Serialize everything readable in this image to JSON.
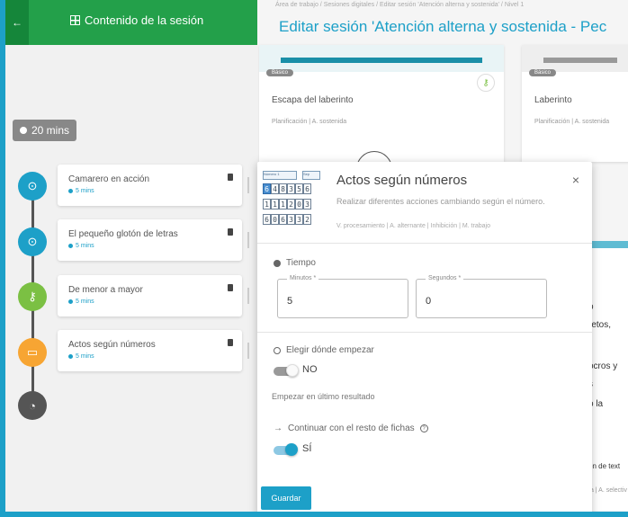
{
  "sidebar": {
    "back_icon": "←",
    "title": "Contenido de la sesión",
    "time_total": "20 mins",
    "items": [
      {
        "name": "Camarero en acción",
        "duration": "5 mins",
        "color": "#1da0c8",
        "icon": "⊙"
      },
      {
        "name": "El pequeño glotón de letras",
        "duration": "5 mins",
        "color": "#1da0c8",
        "icon": "⊙"
      },
      {
        "name": "De menor a mayor",
        "duration": "5 mins",
        "color": "#7bc043",
        "icon": "⚷"
      },
      {
        "name": "Actos según números",
        "duration": "5 mins",
        "color": "#f7a533",
        "icon": "▭"
      }
    ],
    "end_icon": "◔"
  },
  "main": {
    "breadcrumb": "Área de trabajo  /  Sesiones digitales  /  Editar sesión 'Atención alterna y sostenida'  /  Nivel 1",
    "title": "Editar sesión 'Atención alterna y sostenida - Pec",
    "cards": [
      {
        "tag": "Básico",
        "name": "Escapa del laberinto",
        "meta": "Planificación | A. sostenida"
      },
      {
        "tag": "Básico",
        "name": "Laberinto",
        "meta": "Planificación | A. sostenida"
      }
    ],
    "right_texts": [
      "o",
      "retos,",
      "ocros y",
      "s",
      "o la",
      "ón de text",
      "ía | A. selectiv"
    ]
  },
  "popup": {
    "title": "Actos según números",
    "description": "Realizar diferentes acciones cambiando según el número.",
    "tags": "V. procesamiento | A. alternante | Inhibición | M. trabajo",
    "close": "×",
    "thumb_headers": [
      "Número 1",
      "Sep"
    ],
    "thumb_rows": [
      [
        "4",
        "8",
        "3",
        "5",
        "6"
      ],
      [
        "1",
        "1",
        "2",
        "0",
        "3"
      ],
      [
        "0",
        "6",
        "3",
        "3",
        "2"
      ]
    ],
    "thumb_side": [
      "6",
      "1",
      "6"
    ],
    "time_label": "Tiempo",
    "minutes_label": "Minutos *",
    "minutes_value": "5",
    "seconds_label": "Segundos *",
    "seconds_value": "0",
    "choose_label": "Elegir dónde empezar",
    "choose_value": "NO",
    "start_last": "Empezar en último resultado",
    "continue_label": "Continuar con el resto de fichas",
    "continue_value": "SÍ",
    "save_label": "Guardar"
  }
}
